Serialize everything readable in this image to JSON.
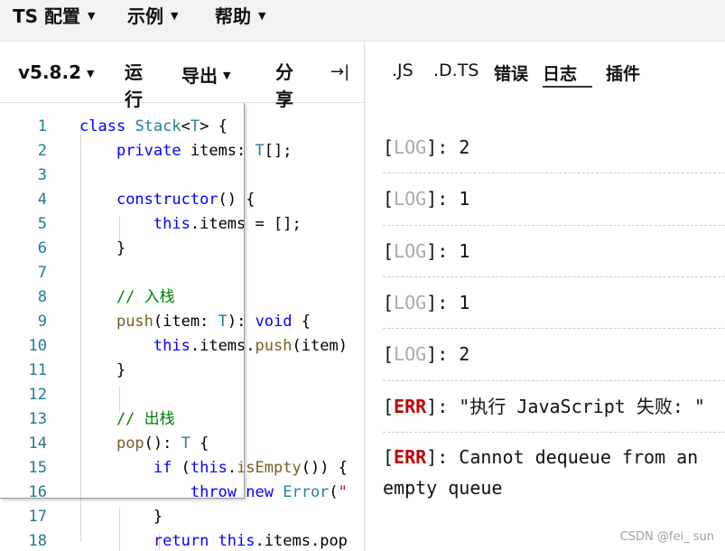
{
  "menu": {
    "ts_config": "TS 配置",
    "examples": "示例",
    "help": "帮助"
  },
  "toolbar": {
    "version": "v5.8.2",
    "run": "运行",
    "export": "导出",
    "share": "分享",
    "collapse_icon": "→|"
  },
  "editor": {
    "lines": [
      {
        "n": "1",
        "code": "class Stack<T> {"
      },
      {
        "n": "2",
        "code": "    private items: T[];"
      },
      {
        "n": "3",
        "code": ""
      },
      {
        "n": "4",
        "code": "    constructor() {"
      },
      {
        "n": "5",
        "code": "        this.items = [];"
      },
      {
        "n": "6",
        "code": "    }"
      },
      {
        "n": "7",
        "code": ""
      },
      {
        "n": "8",
        "code": "    // 入栈"
      },
      {
        "n": "9",
        "code": "    push(item: T): void {"
      },
      {
        "n": "10",
        "code": "        this.items.push(item)"
      },
      {
        "n": "11",
        "code": "    }"
      },
      {
        "n": "12",
        "code": ""
      },
      {
        "n": "13",
        "code": "    // 出栈"
      },
      {
        "n": "14",
        "code": "    pop(): T {"
      },
      {
        "n": "15",
        "code": "        if (this.isEmpty()) {"
      },
      {
        "n": "16",
        "code": "            throw new Error(\""
      },
      {
        "n": "17",
        "code": "        }"
      },
      {
        "n": "18",
        "code": "        return this.items.pop"
      }
    ]
  },
  "output_tabs": [
    ".JS",
    ".D.TS",
    "错误",
    "日志",
    "插件"
  ],
  "logs": [
    {
      "level": "LOG",
      "message": ": 2"
    },
    {
      "level": "LOG",
      "message": ": 1"
    },
    {
      "level": "LOG",
      "message": ": 1"
    },
    {
      "level": "LOG",
      "message": ": 1"
    },
    {
      "level": "LOG",
      "message": ": 2"
    },
    {
      "level": "ERR",
      "message": ": \"执行 JavaScript 失败: \""
    },
    {
      "level": "ERR",
      "message": ": Cannot dequeue from an empty queue"
    }
  ],
  "watermark": "CSDN @fei_ sun",
  "colors": {
    "keyword": "#0000ff",
    "type": "#267f99",
    "line_number": "#237893",
    "comment": "#008000",
    "log_level": "#aaaaaa",
    "error_level": "#c00000"
  }
}
